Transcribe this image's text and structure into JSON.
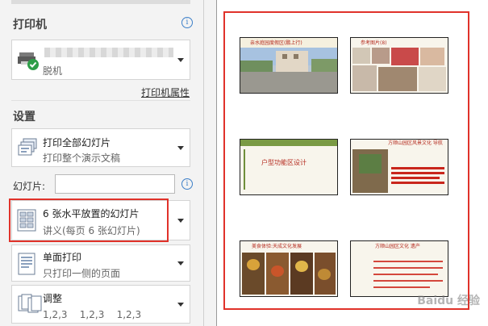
{
  "printer": {
    "section_title": "打印机",
    "status": "脱机",
    "properties_link": "打印机属性"
  },
  "settings": {
    "section_title": "设置",
    "print_range": {
      "title": "打印全部幻灯片",
      "subtitle": "打印整个演示文稿"
    },
    "slides_label": "幻灯片:",
    "slides_input_value": "",
    "layout": {
      "title": "6 张水平放置的幻灯片",
      "subtitle": "讲义(每页 6 张幻灯片)"
    },
    "sides": {
      "title": "单面打印",
      "subtitle": "只打印一侧的页面"
    },
    "collate": {
      "title": "调整",
      "subtitle": "1,2,3    1,2,3    1,2,3"
    }
  },
  "preview": {
    "slides": [
      {
        "caption": "亲水庭园度假区(鹏上行)"
      },
      {
        "caption": "参考图片(8)"
      },
      {
        "caption": "户型功能区设计"
      },
      {
        "caption": "方顺山园区风景文化 导航"
      },
      {
        "caption": "美食体验:天成文化发展"
      },
      {
        "caption": "方顺山园区文化 遗产"
      }
    ]
  },
  "watermark": "Baidu 经验",
  "colors": {
    "highlight": "#e0322a",
    "accent": "#3c7fc8",
    "status_ok": "#2e9e48"
  },
  "icons": [
    "info-icon",
    "printer-icon",
    "slides-stack-icon",
    "handout-grid-icon",
    "single-sided-icon",
    "collate-icon",
    "chevron-down-icon"
  ]
}
